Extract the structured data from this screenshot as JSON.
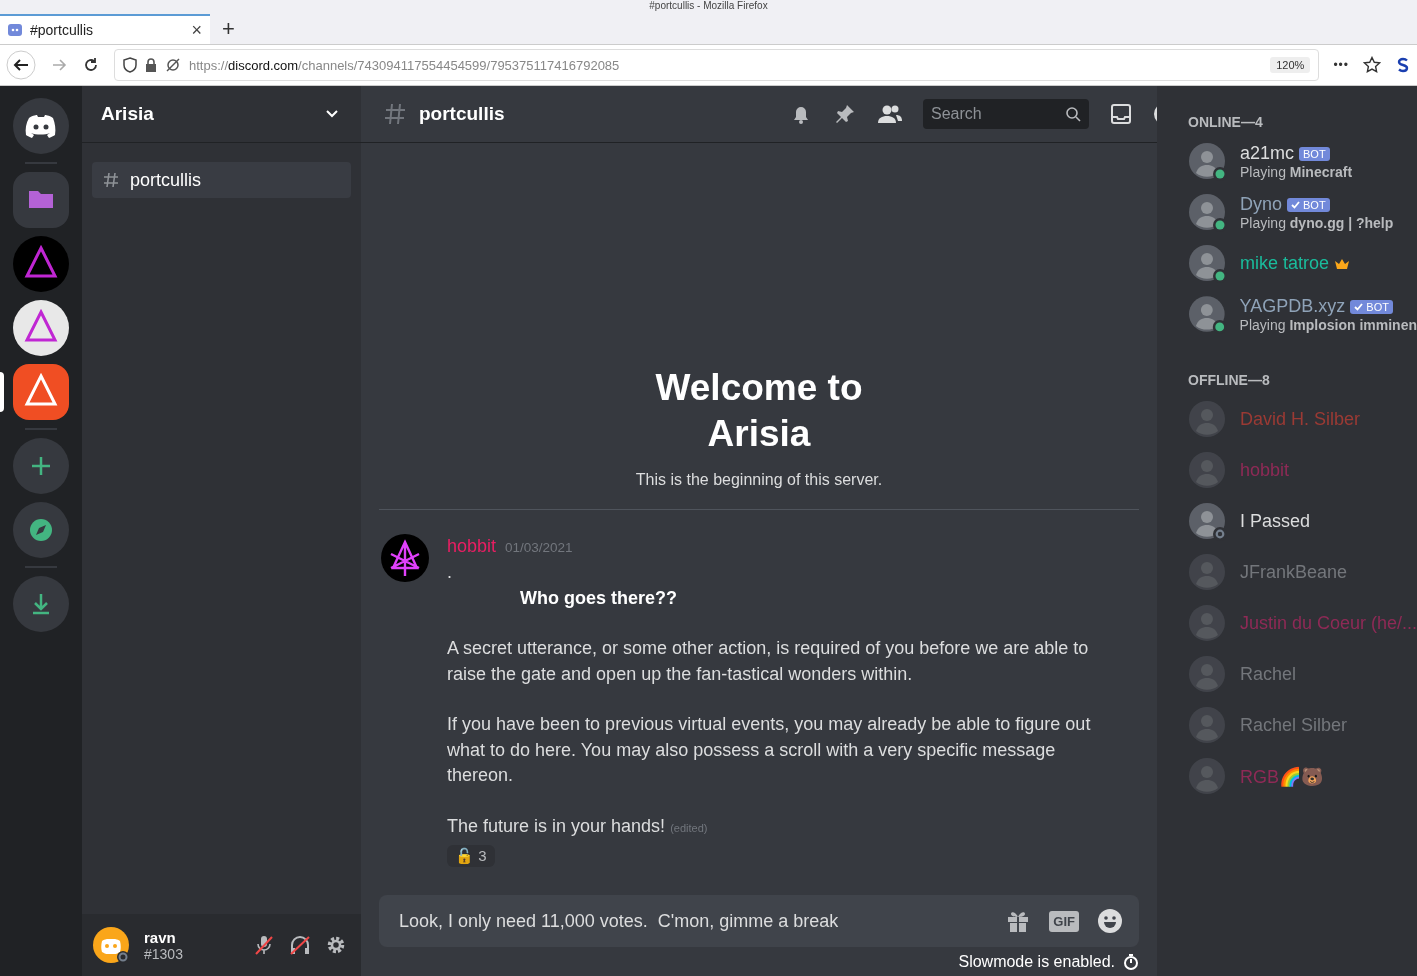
{
  "browser": {
    "title": "#portcullis - Mozilla Firefox",
    "tab": {
      "label": "#portcullis",
      "selected": true,
      "close": "×"
    },
    "new_tab": "+",
    "url": {
      "scheme": "https://",
      "host": "discord.com",
      "path": "/channels/743094117554454599/795375117416792085"
    },
    "zoom": "120%",
    "more": "•••"
  },
  "servers": [
    {
      "kind": "home",
      "selected": false
    },
    {
      "kind": "folder",
      "selected": false
    },
    {
      "kind": "server",
      "selected": false,
      "color": "#000000"
    },
    {
      "kind": "server",
      "selected": false,
      "color": "#e8e8e8"
    },
    {
      "kind": "server",
      "selected": true,
      "color": "#f04e23"
    },
    {
      "kind": "add",
      "selected": false
    },
    {
      "kind": "explore",
      "selected": false
    },
    {
      "kind": "download",
      "selected": false
    }
  ],
  "server_name": "Arisia",
  "channels": [
    {
      "name": "portcullis",
      "selected": true
    }
  ],
  "user": {
    "name": "ravn",
    "tag": "#1303"
  },
  "channel_header": {
    "name": "portcullis",
    "search": {
      "placeholder": "Search"
    }
  },
  "welcome": {
    "title": "Welcome to Arisia",
    "subtitle": "This is the beginning of this server."
  },
  "message": {
    "author": "hobbit",
    "color": "#e91e63",
    "time": "01/03/2021",
    "lines": [
      {
        "kind": "plain",
        "text": "."
      },
      {
        "kind": "heading",
        "text": "Who goes there??"
      },
      {
        "kind": "plain",
        "text": "A secret utterance, or some other action, is required of you before we are able to raise the gate and open up the fan-tastical wonders within."
      },
      {
        "kind": "plain",
        "text": "If you have been to previous virtual events, you may already be able to figure out what to do here.  You may also possess a scroll with a very specific message thereon."
      },
      {
        "kind": "plain",
        "text": "The future is in your hands!",
        "edited": "(edited)"
      }
    ],
    "reaction": {
      "emoji": "🔓",
      "count": "3"
    }
  },
  "composer": {
    "value": "Look, I only need 11,000 votes.  C'mon, gimme a break",
    "gif": "GIF",
    "slowmode": "Slowmode is enabled."
  },
  "member_groups": [
    {
      "title": "ONLINE—4",
      "members": [
        {
          "name": "a21mc",
          "color": "#dcddde",
          "online": true,
          "dimmed": false,
          "invisible": false,
          "badge": "BOT",
          "verified": false,
          "activity": {
            "prefix": "Playing ",
            "game": "Minecraft"
          },
          "owner": false
        },
        {
          "name": "Dyno",
          "color": "#8fa3b8",
          "online": true,
          "dimmed": false,
          "invisible": false,
          "badge": "BOT",
          "verified": true,
          "activity": {
            "prefix": "Playing ",
            "game": "dyno.gg | ?help"
          },
          "owner": false
        },
        {
          "name": "mike tatroe",
          "color": "#1abc9c",
          "online": true,
          "dimmed": false,
          "invisible": false,
          "owner": true
        },
        {
          "name": "YAGPDB.xyz",
          "color": "#8fa3b8",
          "online": true,
          "dimmed": false,
          "invisible": false,
          "badge": "BOT",
          "verified": true,
          "activity": {
            "prefix": "Playing ",
            "game": "Implosion imminen"
          },
          "owner": false
        }
      ]
    },
    {
      "title": "OFFLINE—8",
      "members": [
        {
          "name": "David H. Silber",
          "color": "#9b3a34",
          "online": false,
          "dimmed": true,
          "invisible": false,
          "owner": false
        },
        {
          "name": "hobbit",
          "color": "#8e2a56",
          "online": false,
          "dimmed": true,
          "invisible": false,
          "owner": false
        },
        {
          "name": "I Passed",
          "color": "#dcddde",
          "online": false,
          "dimmed": false,
          "invisible": true,
          "owner": false
        },
        {
          "name": "JFrankBeane",
          "color": "#73767b",
          "online": false,
          "dimmed": true,
          "invisible": false,
          "owner": false
        },
        {
          "name": "Justin du Coeur (he/...",
          "color": "#8e2a56",
          "online": false,
          "dimmed": true,
          "invisible": false,
          "owner": false
        },
        {
          "name": "Rachel",
          "color": "#73767b",
          "online": false,
          "dimmed": true,
          "invisible": false,
          "owner": false
        },
        {
          "name": "Rachel Silber",
          "color": "#73767b",
          "online": false,
          "dimmed": true,
          "invisible": false,
          "owner": false
        },
        {
          "name": "RGB🌈🐻",
          "color": "#8e2a56",
          "online": false,
          "dimmed": true,
          "invisible": false,
          "owner": false
        }
      ]
    }
  ]
}
